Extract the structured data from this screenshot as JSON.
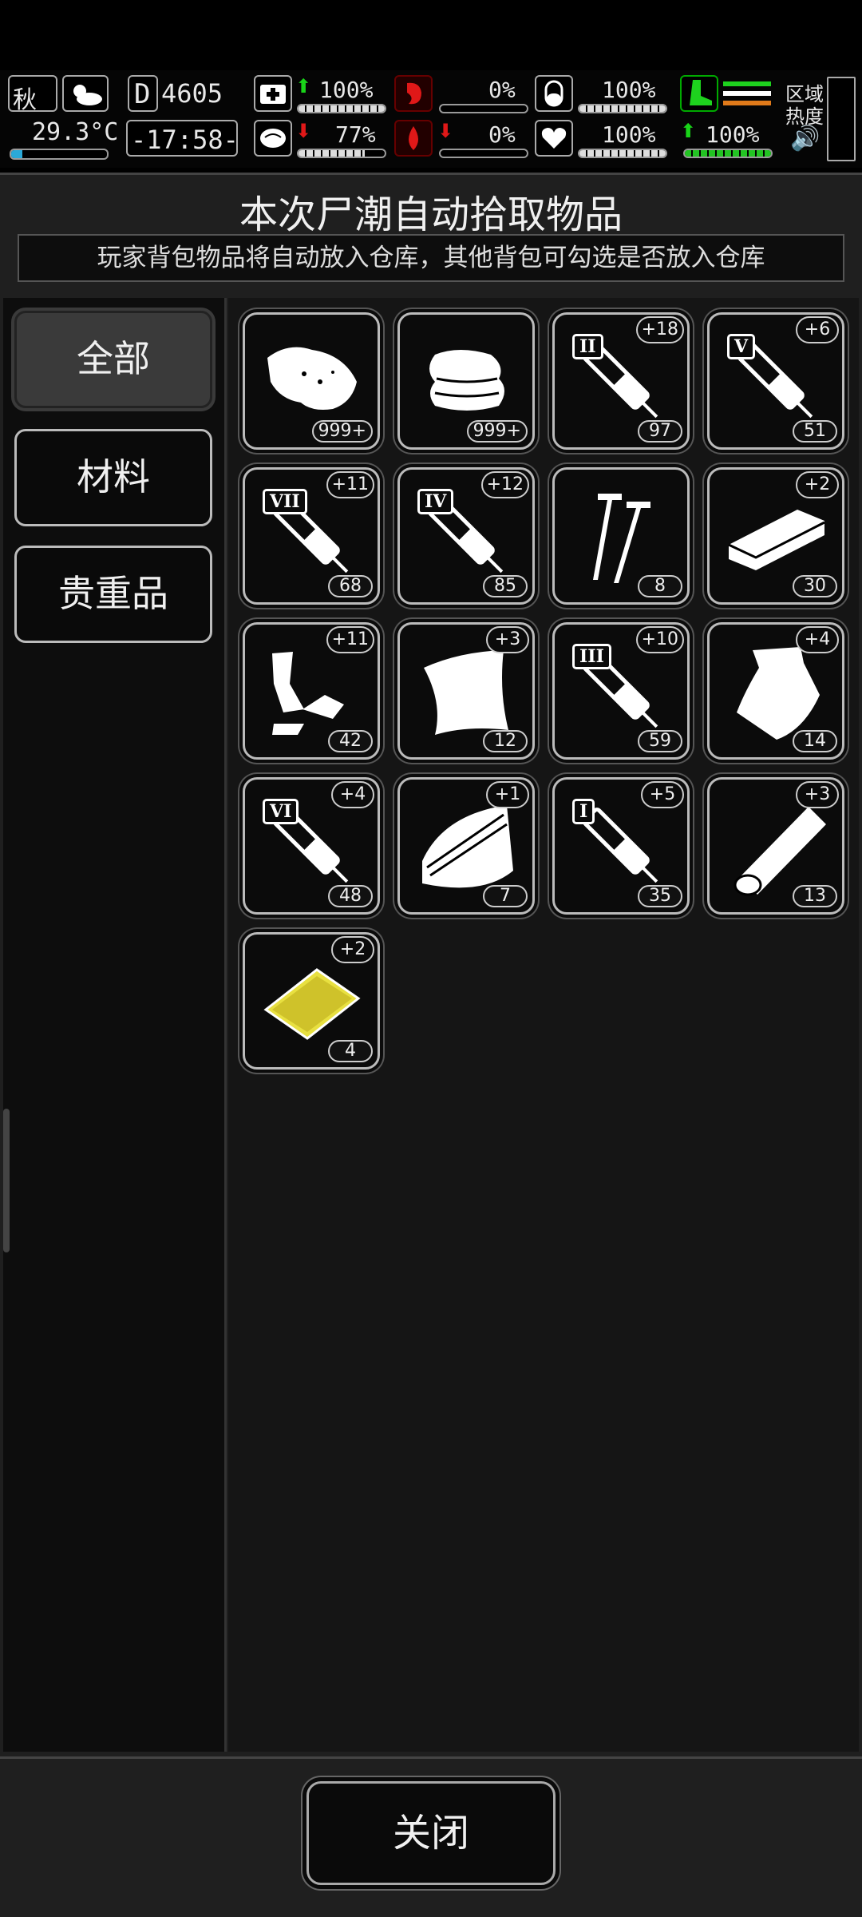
{
  "hud": {
    "season": "秋",
    "temperature": "29.3°C",
    "day_counter": "4605",
    "day_prefix": "D",
    "time": "-17:58-",
    "health": "100%",
    "hunger": "0%",
    "thirst_pill": "100%",
    "sanity": "77%",
    "blood": "0%",
    "heart": "100%",
    "stamina": "100%",
    "zone_label": "区域",
    "heat_label": "热度"
  },
  "panel": {
    "title": "本次尸潮自动拾取物品",
    "subtitle": "玩家背包物品将自动放入仓库，其他背包可勾选是否放入仓库"
  },
  "tabs": [
    {
      "label": "全部",
      "active": true
    },
    {
      "label": "材料",
      "active": false
    },
    {
      "label": "贵重品",
      "active": false
    }
  ],
  "items": [
    {
      "icon": "meat-chunk-icon",
      "count": "999+",
      "plus": ""
    },
    {
      "icon": "cloth-pile-icon",
      "count": "999+",
      "plus": ""
    },
    {
      "icon": "syringe-icon",
      "roman": "II",
      "count": "97",
      "plus": "+18"
    },
    {
      "icon": "syringe-icon",
      "roman": "V",
      "count": "51",
      "plus": "+6"
    },
    {
      "icon": "syringe-icon",
      "roman": "VII",
      "count": "68",
      "plus": "+11"
    },
    {
      "icon": "syringe-icon",
      "roman": "IV",
      "count": "85",
      "plus": "+12"
    },
    {
      "icon": "screws-icon",
      "count": "8",
      "plus": ""
    },
    {
      "icon": "wood-block-icon",
      "count": "30",
      "plus": "+2"
    },
    {
      "icon": "rags-icon",
      "count": "42",
      "plus": "+11"
    },
    {
      "icon": "cloth-sheet-icon",
      "count": "12",
      "plus": "+3"
    },
    {
      "icon": "syringe-icon",
      "roman": "III",
      "count": "59",
      "plus": "+10"
    },
    {
      "icon": "bag-icon",
      "count": "14",
      "plus": "+4"
    },
    {
      "icon": "syringe-icon",
      "roman": "VI",
      "count": "48",
      "plus": "+4"
    },
    {
      "icon": "wood-plank-icon",
      "count": "7",
      "plus": "+1"
    },
    {
      "icon": "syringe-icon",
      "roman": "I",
      "count": "35",
      "plus": "+5"
    },
    {
      "icon": "log-icon",
      "count": "13",
      "plus": "+3"
    },
    {
      "icon": "gold-card-icon",
      "count": "4",
      "plus": "+2"
    }
  ],
  "close_label": "关闭"
}
